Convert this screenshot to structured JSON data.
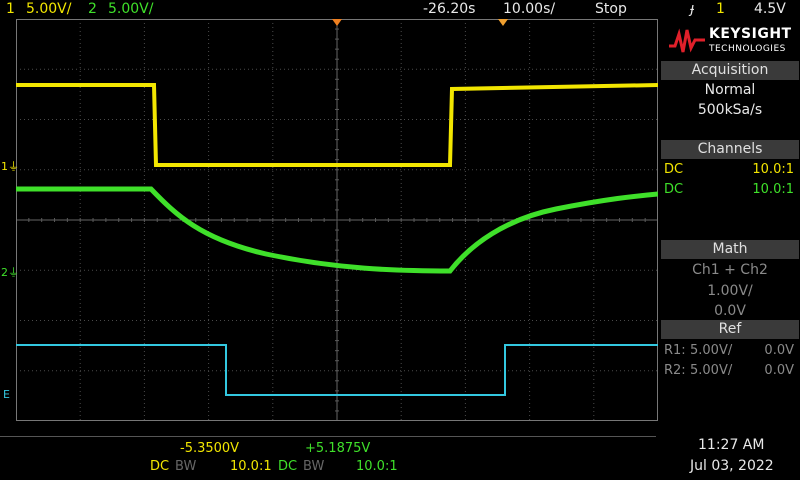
{
  "topbar": {
    "ch1_num": "1",
    "ch1_scale": "5.00V/",
    "ch2_num": "2",
    "ch2_scale": "5.00V/",
    "delay": "-26.20s",
    "timebase": "10.00s/",
    "run_state": "Stop",
    "trigger_icon": "trigger-falling-edge-icon",
    "trigger_level": "4.5V"
  },
  "logo": {
    "brand": "KEYSIGHT",
    "sub": "TECHNOLOGIES"
  },
  "acquisition": {
    "title": "Acquisition",
    "mode": "Normal",
    "rate": "500kSa/s"
  },
  "channels": {
    "title": "Channels",
    "rows": [
      {
        "coupling": "DC",
        "probe": "10.0:1"
      },
      {
        "coupling": "DC",
        "probe": "10.0:1"
      }
    ]
  },
  "math": {
    "title": "Math",
    "expr": "Ch1 + Ch2",
    "scale": "1.00V/",
    "offset": "0.0V"
  },
  "ref": {
    "title": "Ref",
    "rows": [
      {
        "name": "R1:",
        "scale": "5.00V/",
        "offset": "0.0V"
      },
      {
        "name": "R2:",
        "scale": "5.00V/",
        "offset": "0.0V"
      }
    ]
  },
  "markers": {
    "ch1": "1",
    "ch2": "2",
    "ext": "E"
  },
  "bottom": {
    "ch1_offset": "-5.3500V",
    "ch2_offset": "+5.1875V",
    "ch1_coupling": "DC",
    "ch1_bw": "BW",
    "ch1_probe": "10.0:1",
    "ch2_coupling": "DC",
    "ch2_bw": "BW",
    "ch2_probe": "10.0:1",
    "time": "11:27 AM",
    "date": "Jul 03, 2022"
  },
  "colors": {
    "ch1": "#f2e600",
    "ch2": "#3fe02a",
    "math": "#33c8e0",
    "grid": "#555555"
  }
}
